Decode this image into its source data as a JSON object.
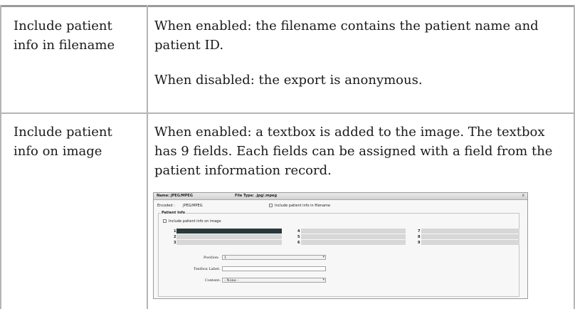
{
  "row1": {
    "setting": "Include patient info in filename",
    "desc_enabled": "When enabled: the filename contains the patient name and patient ID.",
    "desc_disabled": "When disabled: the export is anonymous."
  },
  "row2": {
    "setting": "Include patient info on image",
    "desc": "When enabled: a textbox is added to the image. The textbox has 9 fields. Each fields can be assigned with a field from the patient information record."
  },
  "dialog": {
    "title_name": "Name: JPEG/MPEG",
    "title_filetype": "File Type: .jpg/.mpeg",
    "close": "x",
    "encoded_label": "Encoded :",
    "encoded_value": "JPEG/MPEG",
    "include_filename_label": "Include patient info in filename",
    "group_title": "Patient Info",
    "include_image_label": "Include patient info on image",
    "fields": [
      "1",
      "2",
      "3",
      "4",
      "5",
      "6",
      "7",
      "8",
      "9"
    ],
    "position_label": "Position:",
    "position_value": "1",
    "textbox_label": "Textbox Label:",
    "content_label": "Content:",
    "content_value": "- None -"
  },
  "colors": {
    "grid": "#b5b5b5",
    "active_field": "#28393b",
    "field": "#d7d7d7"
  }
}
